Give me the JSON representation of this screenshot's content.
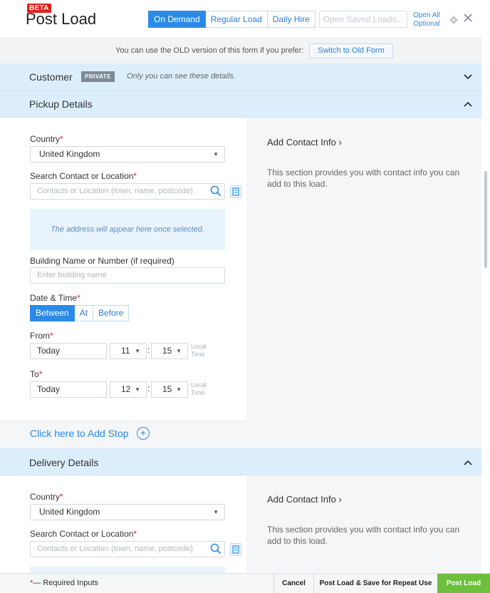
{
  "header": {
    "badge": "BETA",
    "title": "Post Load",
    "modes": [
      "On Demand",
      "Regular Load",
      "Daily Hire"
    ],
    "active_mode": "On Demand",
    "open_saved_placeholder": "Open Saved Loads...",
    "open_all_line1": "Open All",
    "open_all_line2": "Optional",
    "icons": {
      "settings": "gear-icon",
      "close": "close-icon"
    }
  },
  "banner": {
    "text": "You can use the OLD version of this form if you prefer:",
    "button": "Switch to Old Form"
  },
  "customer": {
    "label": "Customer",
    "badge": "PRIVATE",
    "note": "Only you can see these details.",
    "expanded": false
  },
  "pickup": {
    "label": "Pickup Details",
    "expanded": true,
    "country_label": "Country",
    "country_value": "United Kingdom",
    "search_label": "Search Contact or Location",
    "search_placeholder": "Contacts or Location (town, name, postcode)",
    "address_hint": "The address will appear here once selected.",
    "building_label": "Building Name or Number (if required)",
    "building_placeholder": "Enter building name",
    "datetime_label": "Date & Time",
    "datetime_modes": [
      "Between",
      "At",
      "Before"
    ],
    "active_datetime_mode": "Between",
    "from_label": "From",
    "from_date": "Today",
    "from_hour": "11",
    "from_minute": "15",
    "to_label": "To",
    "to_date": "Today",
    "to_hour": "12",
    "to_minute": "15",
    "local_line1": "Local",
    "local_line2": "Time",
    "contact_link": "Add Contact Info",
    "contact_note": "This section provides you with contact info you can add to this load."
  },
  "add_stop": {
    "label": "Click here to Add Stop",
    "icon": "plus-circle-icon"
  },
  "delivery": {
    "label": "Delivery Details",
    "expanded": true,
    "country_label": "Country",
    "country_value": "United Kingdom",
    "search_label": "Search Contact or Location",
    "search_placeholder": "Contacts or Location (town, name, postcode)",
    "contact_link": "Add Contact Info",
    "contact_note": "This section provides you with contact info you can add to this load."
  },
  "footer": {
    "required_marker": "*",
    "required_note": "— Required Inputs",
    "cancel": "Cancel",
    "save_repeat": "Post Load & Save for Repeat Use",
    "post": "Post Load"
  },
  "colors": {
    "accent": "#2a8be6",
    "section_header": "#dceefc",
    "required": "#e0211b",
    "post_button": "#6dbf3c",
    "private_badge": "#7d8a96"
  }
}
